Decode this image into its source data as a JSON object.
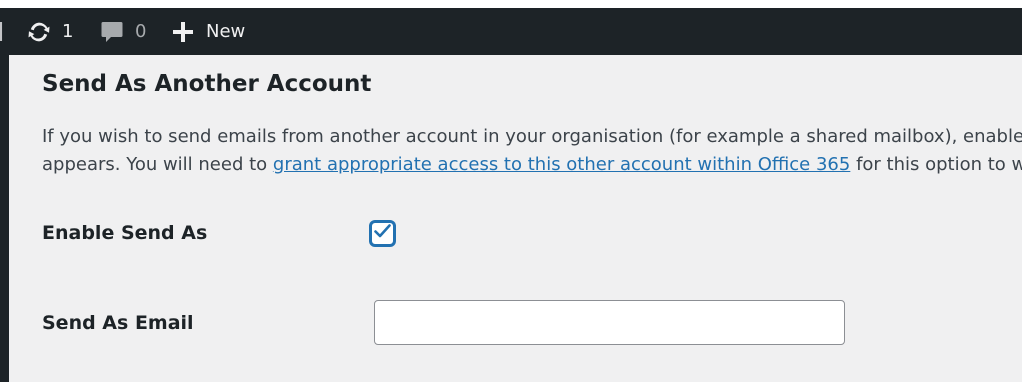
{
  "admin_bar": {
    "updates_count": "1",
    "comments_count": "0",
    "new_label": "New"
  },
  "section": {
    "title": "Send As Another Account",
    "description_line1": "If you wish to send emails from another account in your organisation (for example a shared mailbox), enable the option below and enter the account's email address in the field that appears.",
    "description_line2_before": "appears. You will need to ",
    "description_link": "grant appropriate access to this other account within Office 365",
    "description_line2_after": " for this option to work."
  },
  "fields": {
    "enable_send_as": {
      "label": "Enable Send As",
      "checked": true
    },
    "send_as_email": {
      "label": "Send As Email",
      "value": "",
      "placeholder": ""
    }
  },
  "colors": {
    "admin_bar_bg": "#1d2327",
    "content_bg": "#f0f0f1",
    "accent": "#2271b1"
  },
  "icons": {
    "updates": "refresh-icon",
    "comments": "comment-bubble-icon",
    "new": "plus-icon"
  }
}
